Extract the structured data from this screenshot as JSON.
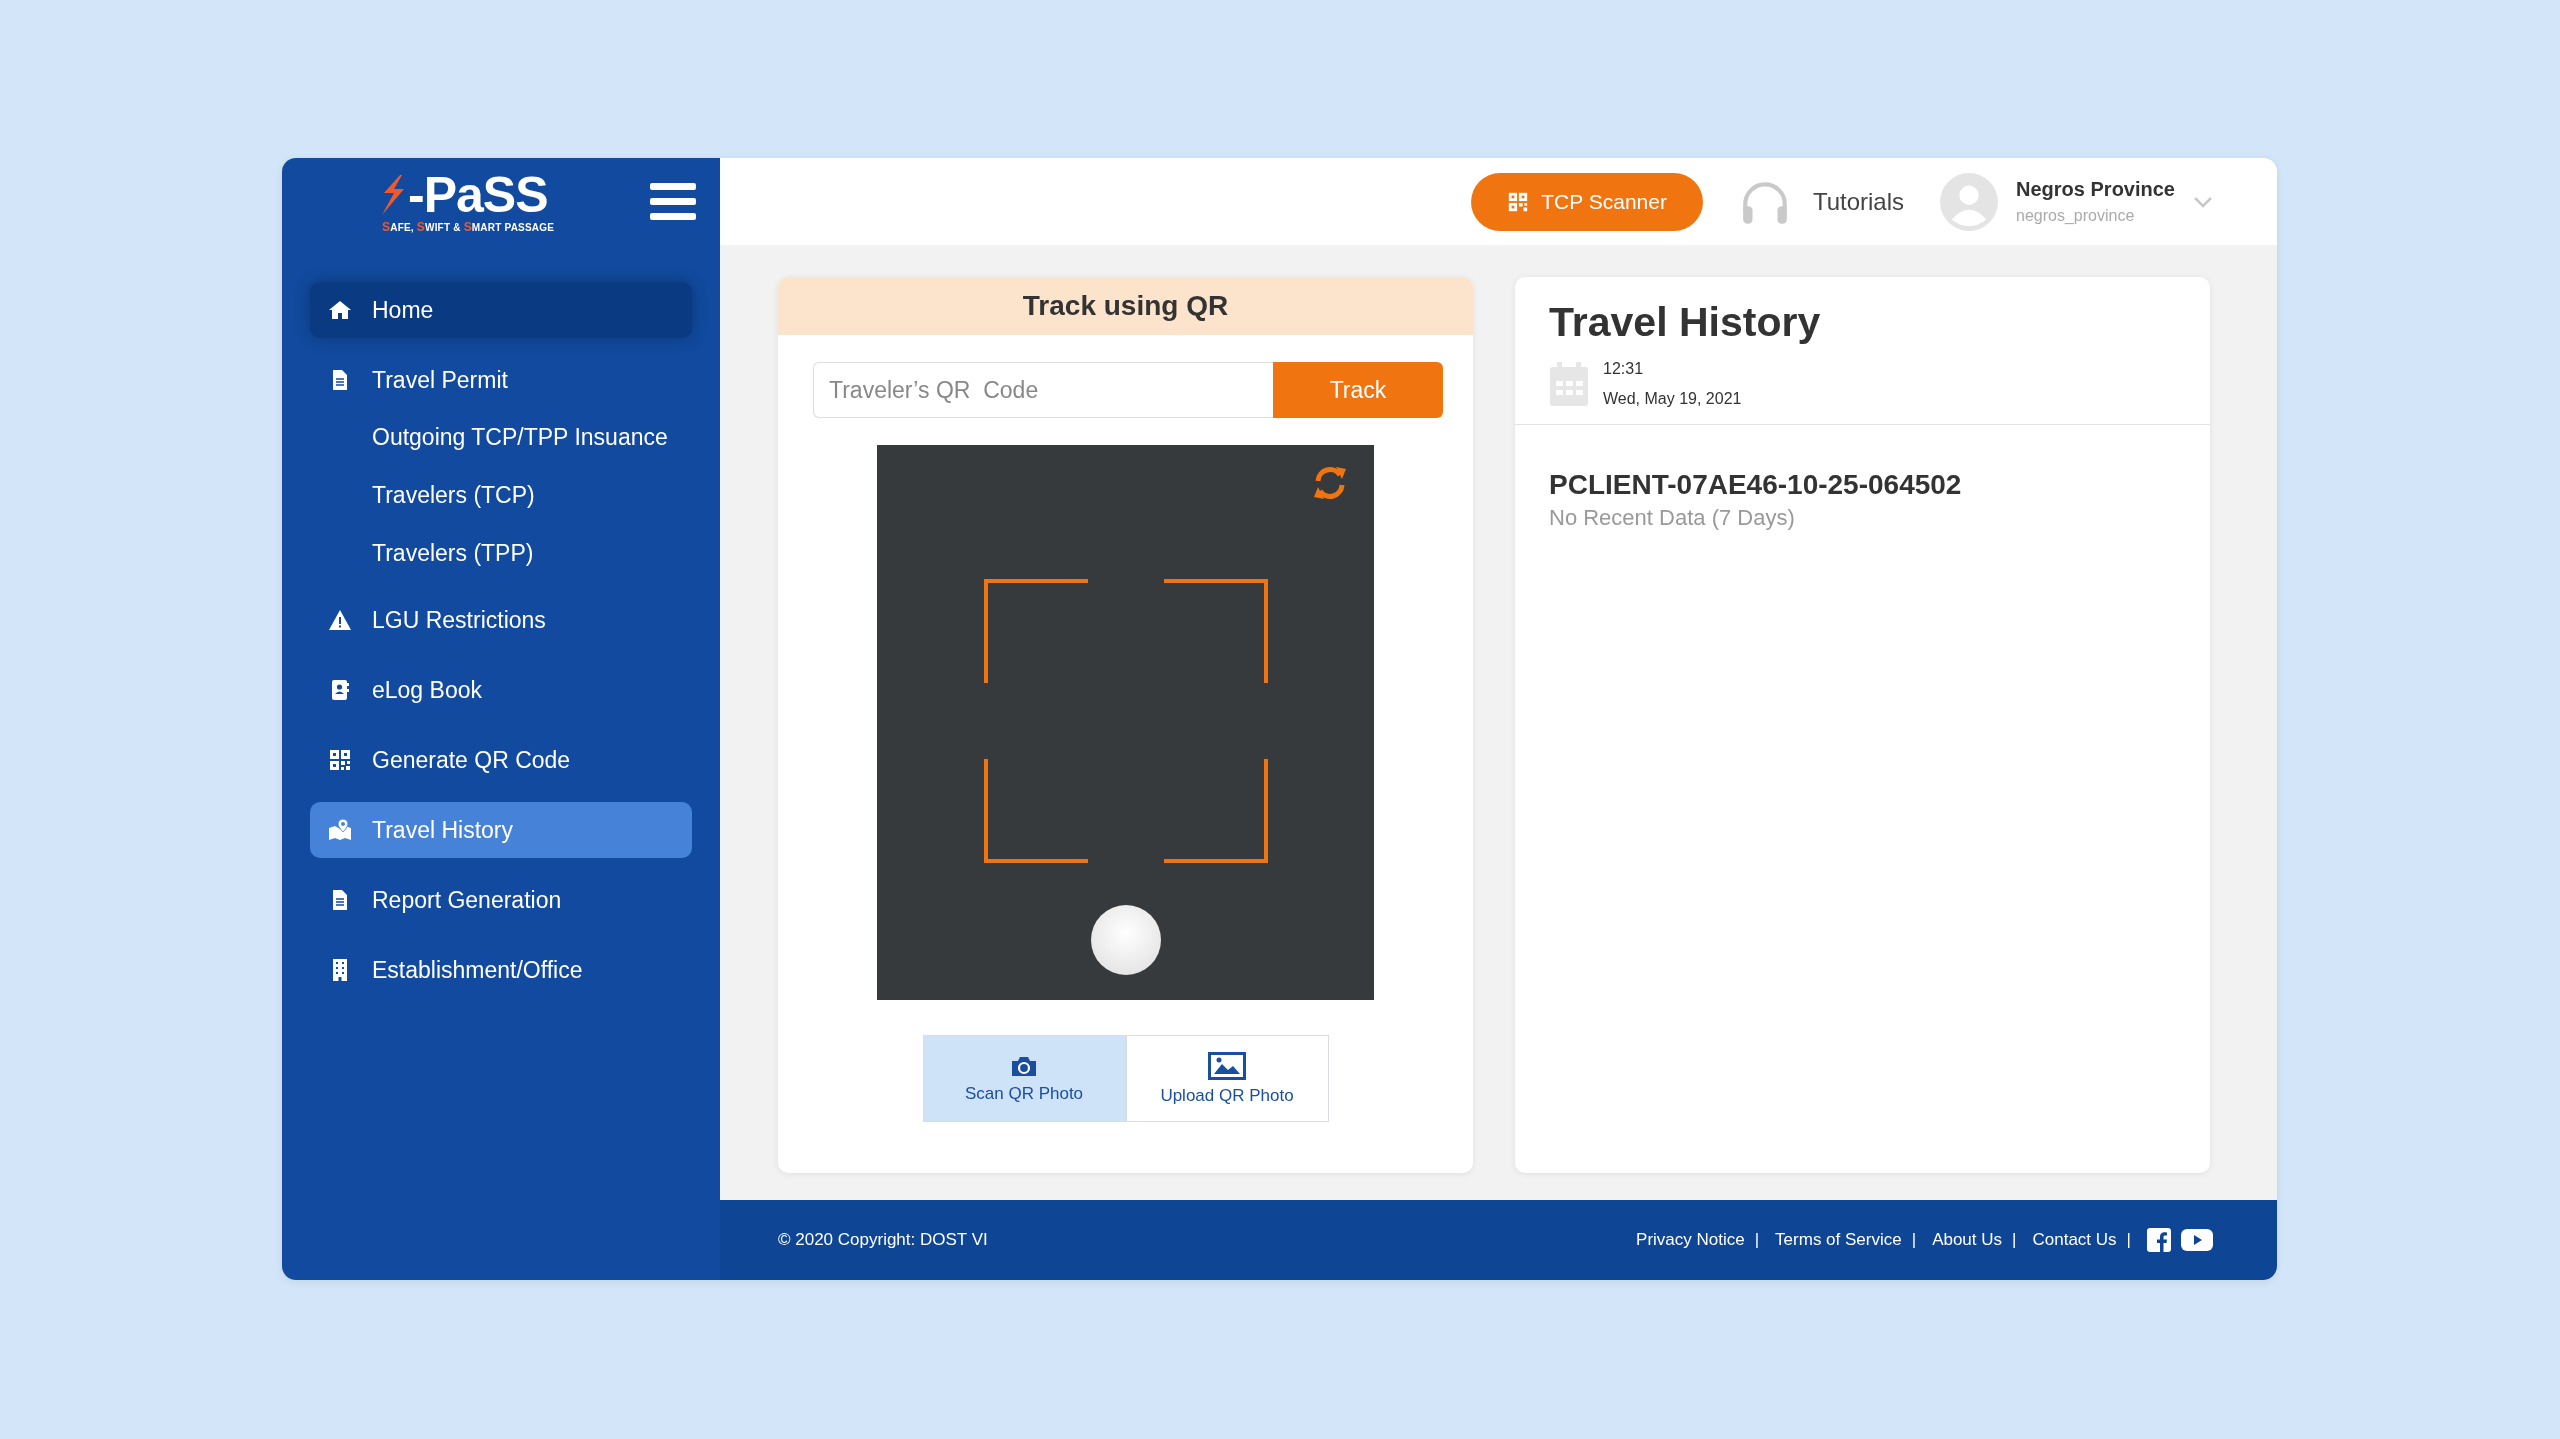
{
  "sidebar": {
    "logo": {
      "wordmark": "-PaSS",
      "tagline": [
        {
          "text": "S",
          "accent": true
        },
        {
          "text": "AFE, ",
          "accent": false
        },
        {
          "text": "S",
          "accent": true
        },
        {
          "text": "WIFT & ",
          "accent": false
        },
        {
          "text": "S",
          "accent": true
        },
        {
          "text": "MART PASSAGE",
          "accent": false
        }
      ]
    },
    "items": [
      {
        "label": "Home",
        "kind": "item",
        "selected": false,
        "hovered": true
      },
      {
        "label": "Travel Permit",
        "kind": "item",
        "selected": false,
        "hovered": false
      },
      {
        "label": "Outgoing TCP/TPP Insuance",
        "kind": "subitem",
        "selected": false,
        "hovered": false
      },
      {
        "label": "Travelers (TCP)",
        "kind": "subitem",
        "selected": false,
        "hovered": false
      },
      {
        "label": "Travelers (TPP)",
        "kind": "subitem",
        "selected": false,
        "hovered": false
      },
      {
        "label": "LGU Restrictions",
        "kind": "item",
        "selected": false,
        "hovered": false
      },
      {
        "label": "eLog Book",
        "kind": "item",
        "selected": false,
        "hovered": false
      },
      {
        "label": "Generate QR Code",
        "kind": "item",
        "selected": false,
        "hovered": false
      },
      {
        "label": "Travel History",
        "kind": "item",
        "selected": true,
        "hovered": false
      },
      {
        "label": "Report Generation",
        "kind": "item",
        "selected": false,
        "hovered": false
      },
      {
        "label": "Establishment/Office",
        "kind": "item",
        "selected": false,
        "hovered": false
      }
    ]
  },
  "header": {
    "scanner_button": "TCP Scanner",
    "tutorials": "Tutorials",
    "user": {
      "name": "Negros Province",
      "username": "negros_province"
    }
  },
  "track_panel": {
    "title": "Track using QR",
    "input": {
      "placeholder": "Traveler’s QR  Code"
    },
    "track_button": "Track",
    "modes": [
      {
        "label": "Scan QR Photo",
        "selected": true
      },
      {
        "label": "Upload QR Photo",
        "selected": false
      }
    ]
  },
  "history": {
    "title": "Travel History",
    "time": "12:31",
    "date": "Wed, May 19, 2021",
    "client_id": "PCLIENT-07AE46-10-25-064502",
    "status": "No Recent Data (7 Days)"
  },
  "footer": {
    "copyright": "© 2020 Copyright: DOST VI",
    "links": [
      {
        "label": "Privacy Notice",
        "separator": "|"
      },
      {
        "label": "Terms of Service",
        "separator": "|"
      },
      {
        "label": "About Us",
        "separator": "|"
      },
      {
        "label": "Contact Us",
        "separator": "|"
      }
    ]
  }
}
